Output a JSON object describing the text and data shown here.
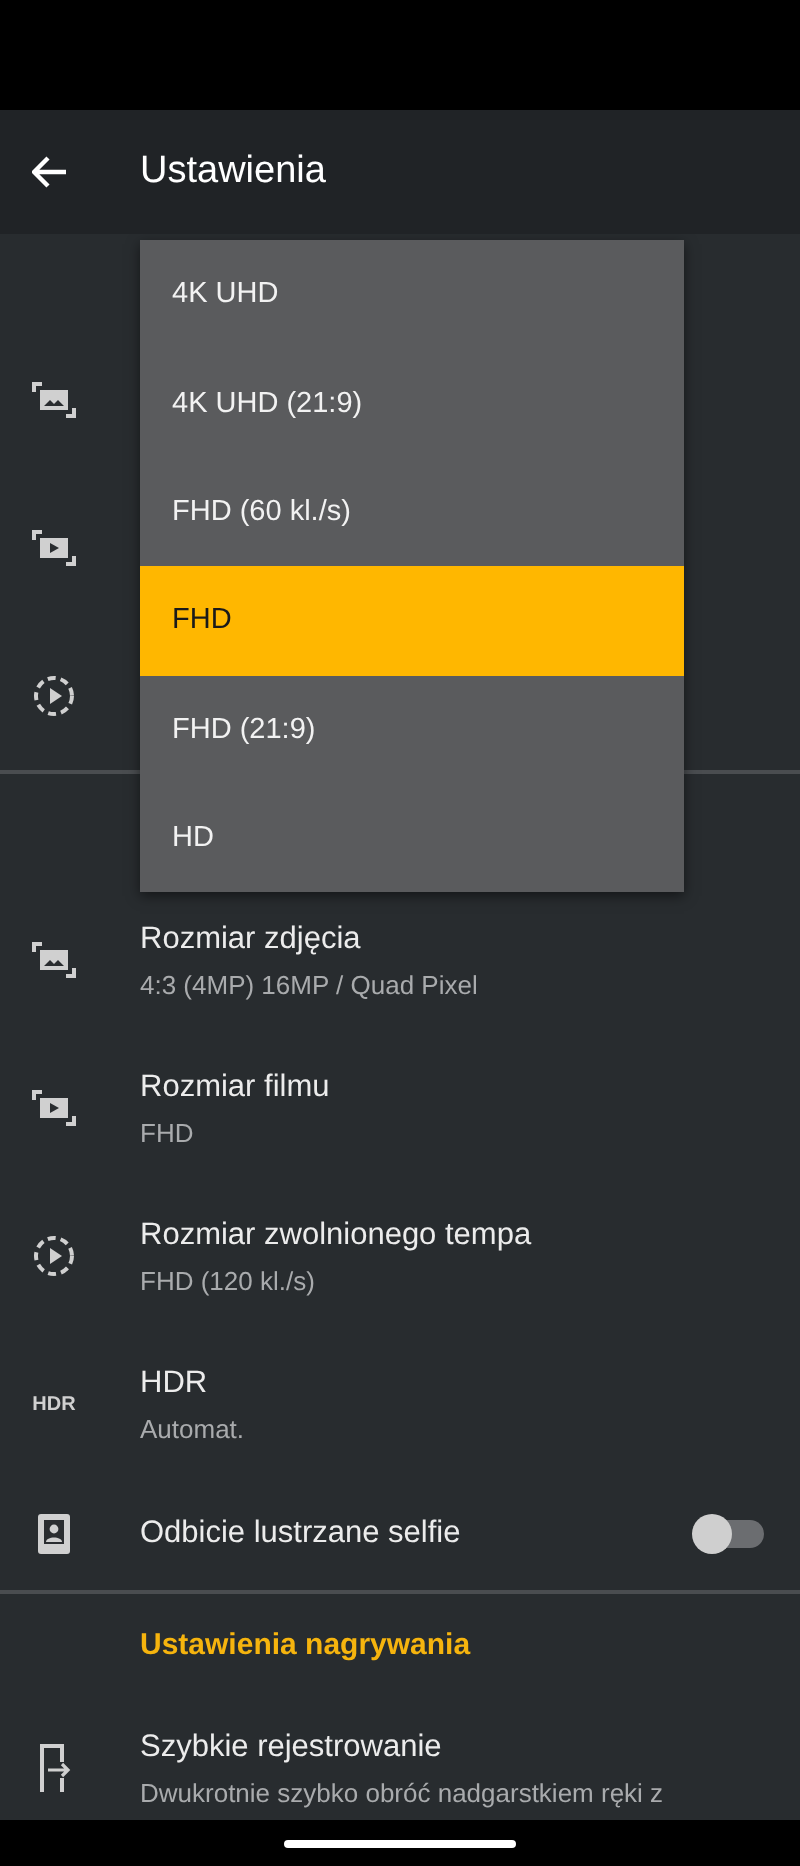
{
  "app_bar": {
    "title": "Ustawienia"
  },
  "dropdown": {
    "options": [
      {
        "label": "4K UHD",
        "selected": false
      },
      {
        "label": "4K UHD (21:9)",
        "selected": false
      },
      {
        "label": "FHD (60 kl./s)",
        "selected": false
      },
      {
        "label": "FHD",
        "selected": true
      },
      {
        "label": "FHD (21:9)",
        "selected": false
      },
      {
        "label": "HD",
        "selected": false
      }
    ]
  },
  "settings": [
    {
      "kind": "value",
      "title": "Rozmiar zdjęcia",
      "subtitle": "4:3 (4MP) 16MP / Quad Pixel"
    },
    {
      "kind": "value",
      "title": "Rozmiar filmu",
      "subtitle": "FHD"
    },
    {
      "kind": "value",
      "title": "Rozmiar zwolnionego tempa",
      "subtitle": "FHD (120 kl./s)"
    },
    {
      "kind": "value",
      "title": "HDR",
      "subtitle": "Automat.",
      "icon_text": "HDR"
    },
    {
      "kind": "toggle",
      "title": "Odbicie lustrzane selfie",
      "on": false
    },
    {
      "kind": "section",
      "title": "Ustawienia nagrywania"
    },
    {
      "kind": "value",
      "title": "Szybkie rejestrowanie",
      "subtitle": "Dwukrotnie szybko obróć nadgarstkiem ręki z"
    }
  ]
}
